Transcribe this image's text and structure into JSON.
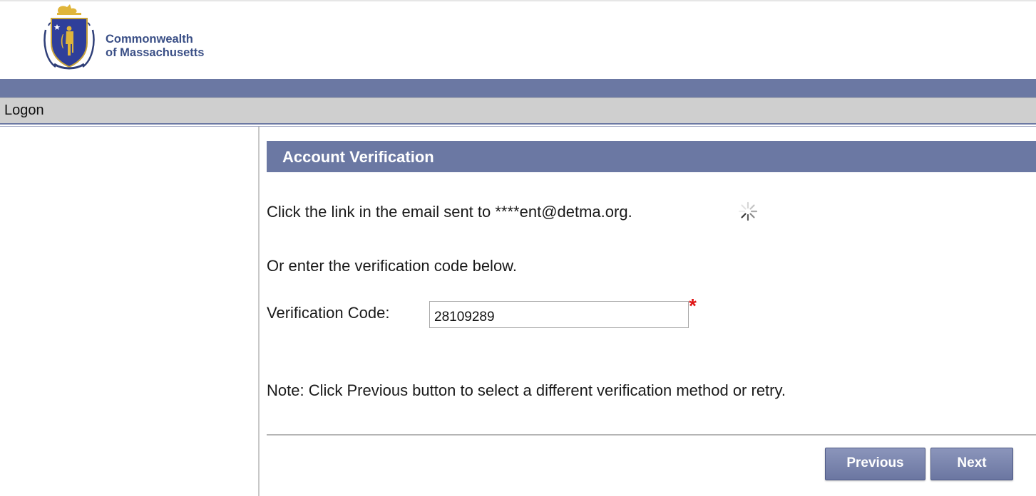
{
  "header": {
    "agency_line1": "Commonwealth",
    "agency_line2": "of Massachusetts",
    "logo_icon": "massachusetts-seal-icon"
  },
  "menu": {
    "logon_label": "Logon"
  },
  "panel": {
    "title": "Account Verification",
    "email_instruction": "Click the link in the email sent to ****ent@detma.org.",
    "spinner_icon": "loading-spinner-icon",
    "code_instruction": "Or enter the verification code below.",
    "code_label": "Verification Code:",
    "code_value": "28109289",
    "required_marker": "*",
    "note": "Note: Click Previous button to select a different verification method or retry."
  },
  "buttons": {
    "previous_label": "Previous",
    "next_label": "Next"
  },
  "colors": {
    "accent": "#6b78a3",
    "menu_bar": "#cfcfcf",
    "agency_text": "#3a4f86",
    "required": "#e01616"
  }
}
